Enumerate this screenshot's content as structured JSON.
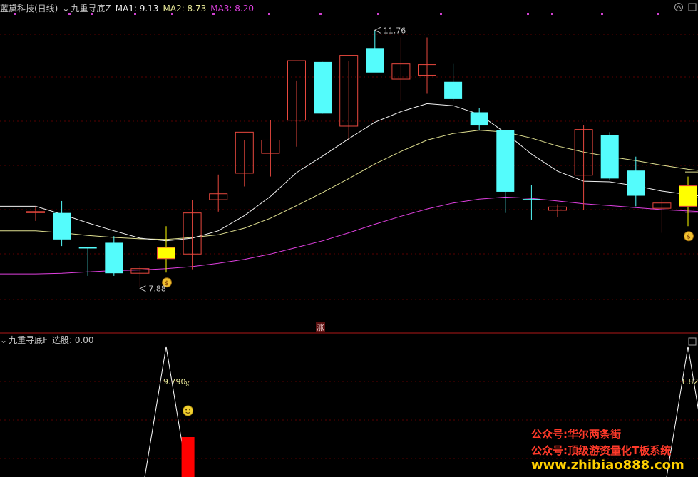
{
  "main_panel": {
    "stock_title": "蓝黛科技(日线)",
    "indicator_name": "九重寻底Z",
    "ma1_label": "MA1: 9.13",
    "ma2_label": "MA2: 8.73",
    "ma3_label": "MA3: 8.20",
    "high_label": "11.76",
    "low_label": "7.88",
    "zhang_marker": "涨"
  },
  "sub_panel": {
    "indicator_name": "九重寻底F",
    "value_label": "选股: 0.00",
    "left_pct_label": "9.790",
    "left_pct_suffix": "%",
    "right_pct_label": "1.82"
  },
  "watermarks": {
    "line1": "公众号:华尔两条街",
    "line2": "公众号:顶级游资量化T板系统",
    "line3": "www.zhibiao888.com"
  },
  "colors": {
    "up": "#e8483e",
    "down": "#54fcfc",
    "signal": "#ffff00",
    "ma1": "#f0f0f0",
    "ma2": "#e0e090",
    "ma3": "#e040e0",
    "panel_divider": "#b01818",
    "grid": "#5a0000"
  },
  "chart_data": [
    {
      "type": "candlestick",
      "title": "九重寻底Z",
      "ylim": [
        7.5,
        12.0
      ],
      "candles": [
        {
          "o": 9.02,
          "h": 9.1,
          "l": 8.88,
          "c": 9.02,
          "color": "up"
        },
        {
          "o": 9.0,
          "h": 9.18,
          "l": 8.5,
          "c": 8.6,
          "color": "down"
        },
        {
          "o": 8.48,
          "h": 8.48,
          "l": 8.05,
          "c": 8.48,
          "color": "doji-down"
        },
        {
          "o": 8.55,
          "h": 8.65,
          "l": 8.05,
          "c": 8.09,
          "color": "down"
        },
        {
          "o": 8.09,
          "h": 8.2,
          "l": 7.88,
          "c": 8.16,
          "color": "up"
        },
        {
          "o": 8.31,
          "h": 8.8,
          "l": 8.1,
          "c": 8.48,
          "color": "signal"
        },
        {
          "o": 8.38,
          "h": 9.2,
          "l": 8.15,
          "c": 9.0,
          "color": "up"
        },
        {
          "o": 9.2,
          "h": 9.58,
          "l": 9.02,
          "c": 9.29,
          "color": "up"
        },
        {
          "o": 9.6,
          "h": 10.1,
          "l": 9.4,
          "c": 10.22,
          "color": "up"
        },
        {
          "o": 9.9,
          "h": 10.4,
          "l": 9.55,
          "c": 10.1,
          "color": "up"
        },
        {
          "o": 10.4,
          "h": 11.0,
          "l": 10.0,
          "c": 11.3,
          "color": "up"
        },
        {
          "o": 11.28,
          "h": 11.28,
          "l": 10.5,
          "c": 10.5,
          "color": "down"
        },
        {
          "o": 10.31,
          "h": 11.3,
          "l": 10.1,
          "c": 11.38,
          "color": "up"
        },
        {
          "o": 11.48,
          "h": 11.76,
          "l": 11.15,
          "c": 11.12,
          "color": "down"
        },
        {
          "o": 11.02,
          "h": 11.65,
          "l": 10.7,
          "c": 11.25,
          "color": "up"
        },
        {
          "o": 11.08,
          "h": 11.65,
          "l": 10.8,
          "c": 11.24,
          "color": "up"
        },
        {
          "o": 10.98,
          "h": 11.25,
          "l": 10.7,
          "c": 10.72,
          "color": "down"
        },
        {
          "o": 10.52,
          "h": 10.58,
          "l": 10.25,
          "c": 10.32,
          "color": "down"
        },
        {
          "o": 10.25,
          "h": 10.25,
          "l": 9.0,
          "c": 9.32,
          "color": "down"
        },
        {
          "o": 9.21,
          "h": 9.42,
          "l": 8.9,
          "c": 9.21,
          "color": "doji-down"
        },
        {
          "o": 9.04,
          "h": 9.13,
          "l": 8.94,
          "c": 9.09,
          "color": "up"
        },
        {
          "o": 9.57,
          "h": 10.32,
          "l": 9.04,
          "c": 10.26,
          "color": "up"
        },
        {
          "o": 10.18,
          "h": 10.22,
          "l": 9.5,
          "c": 9.52,
          "color": "down"
        },
        {
          "o": 9.64,
          "h": 9.85,
          "l": 9.1,
          "c": 9.26,
          "color": "down"
        },
        {
          "o": 9.07,
          "h": 9.22,
          "l": 8.7,
          "c": 9.15,
          "color": "up"
        },
        {
          "o": 9.1,
          "h": 9.55,
          "l": 8.8,
          "c": 9.41,
          "color": "signal"
        },
        {
          "o": 9.16,
          "h": 9.16,
          "l": 9.1,
          "c": 9.16,
          "color": "doji-down"
        }
      ],
      "ma1": [
        9.1,
        8.98,
        8.85,
        8.73,
        8.62,
        8.58,
        8.62,
        8.73,
        8.96,
        9.25,
        9.61,
        9.86,
        10.12,
        10.37,
        10.53,
        10.65,
        10.62,
        10.49,
        10.21,
        9.89,
        9.63,
        9.48,
        9.47,
        9.41,
        9.33,
        9.28,
        9.23
      ],
      "ma2": [
        8.73,
        8.7,
        8.66,
        8.63,
        8.61,
        8.6,
        8.63,
        8.67,
        8.77,
        8.92,
        9.11,
        9.31,
        9.52,
        9.74,
        9.93,
        10.1,
        10.2,
        10.25,
        10.22,
        10.13,
        10.01,
        9.92,
        9.85,
        9.79,
        9.72,
        9.66,
        9.62
      ],
      "ma3": [
        8.08,
        8.09,
        8.11,
        8.13,
        8.14,
        8.16,
        8.19,
        8.24,
        8.3,
        8.38,
        8.48,
        8.58,
        8.7,
        8.83,
        8.95,
        9.06,
        9.15,
        9.21,
        9.24,
        9.22,
        9.18,
        9.14,
        9.11,
        9.08,
        9.05,
        9.03,
        9.01
      ]
    },
    {
      "type": "line",
      "title": "九重寻底F",
      "series_name": "选股",
      "spikes": [
        {
          "index": 5,
          "value": 1.0,
          "pct": "9.790%"
        },
        {
          "index": 25,
          "value": 1.0,
          "pct": "1.82"
        }
      ],
      "bars": [
        {
          "index": 6,
          "value": 1.0
        },
        {
          "index": 26,
          "value": 1.0
        }
      ]
    }
  ]
}
